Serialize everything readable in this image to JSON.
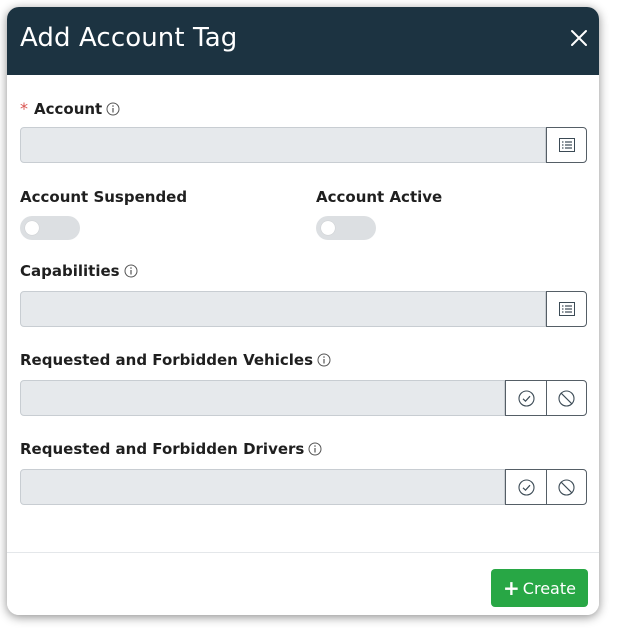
{
  "dialog": {
    "title": "Add Account Tag"
  },
  "fields": {
    "account": {
      "label": "Account",
      "required_mark": "*",
      "value": "",
      "placeholder": ""
    },
    "account_suspended": {
      "label": "Account Suspended",
      "on": false
    },
    "account_active": {
      "label": "Account Active",
      "on": false
    },
    "capabilities": {
      "label": "Capabilities",
      "value": "",
      "placeholder": ""
    },
    "vehicles": {
      "label": "Requested and Forbidden Vehicles",
      "value": "",
      "placeholder": ""
    },
    "drivers": {
      "label": "Requested and Forbidden Drivers",
      "value": "",
      "placeholder": ""
    }
  },
  "footer": {
    "create_plus": "+",
    "create_label": "Create"
  },
  "icons": {
    "close": "close-icon",
    "info": "info-icon",
    "list": "list-icon",
    "check": "check-circle-icon",
    "forbid": "forbidden-icon"
  },
  "colors": {
    "header_bg": "#1c3341",
    "input_bg": "#e6e9ec",
    "create_bg": "#28a745",
    "required": "#d9534f"
  }
}
